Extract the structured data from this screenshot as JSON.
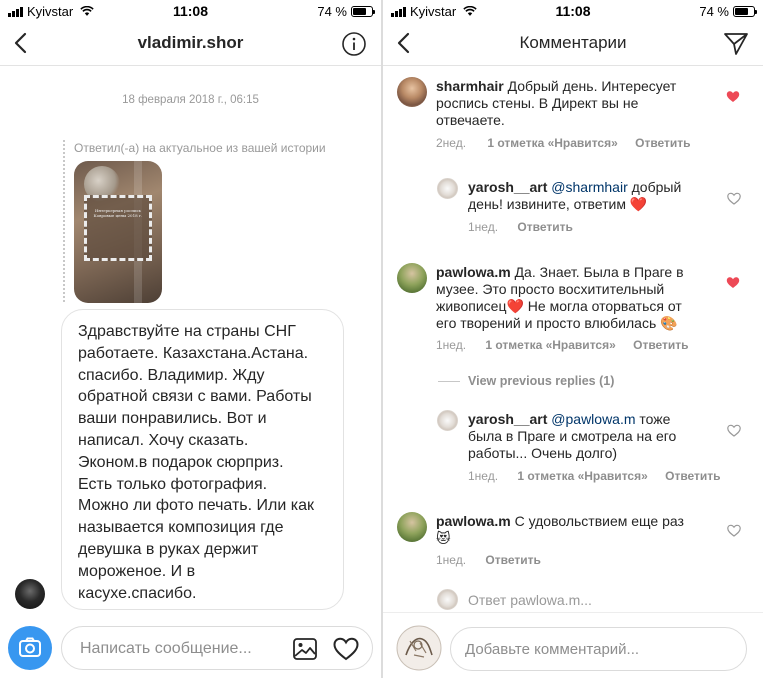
{
  "left": {
    "status": {
      "carrier": "Kyivstar",
      "time": "11:08",
      "battery": "74 %",
      "battery_level": 0.74
    },
    "title": "vladimir.shor",
    "date": "18 февраля 2018 г., 06:15",
    "reply_note": "Ответил(-а) на актуальное из вашей истории",
    "story_text": "Интерьерная роспись Ковровые цены 2018 г.",
    "message_lines": [
      "Здравствуйте на страны СНГ",
      "работаете. Казахстана.Астана.",
      "спасибо. Владимир. Жду",
      "обратной связи с вами. Работы",
      "ваши понравились. Вот и",
      "написал. Хочу сказать.",
      "Эконом.в подарок сюрприз.",
      "Есть только фотография.",
      "Можно ли фото печать. Или как",
      "называется композиция где",
      "девушка в руках держит",
      "мороженое. И в",
      "касухе.спасибо."
    ],
    "composer_placeholder": "Написать сообщение..."
  },
  "right": {
    "status": {
      "carrier": "Kyivstar",
      "time": "11:08",
      "battery": "74 %",
      "battery_level": 0.74
    },
    "title": "Комментарии",
    "comments": [
      {
        "user": "sharmhair",
        "text_lines": [
          "Добрый день. Интересует",
          "роспись стены. В Директ вы не",
          "отвечаете."
        ],
        "time": "2нед.",
        "likes": "1 отметка «Нравится»",
        "reply": "Ответить",
        "liked": true
      },
      {
        "user": "yarosh__art",
        "mention": "@sharmhair",
        "text_lines": [
          "добрый",
          "день! извините, ответим ❤️"
        ],
        "time": "1нед.",
        "reply": "Ответить",
        "liked": false
      },
      {
        "user": "pawlowa.m",
        "text_lines": [
          "Да. Знает. Была в Праге в",
          "музее. Это просто восхитительный",
          "живописец❤️ Не могла оторваться от",
          "его творений и просто влюбилась 🎨"
        ],
        "time": "1нед.",
        "likes": "1 отметка «Нравится»",
        "reply": "Ответить",
        "liked": true
      },
      {
        "user": "yarosh__art",
        "mention": "@pawlowa.m",
        "text_lines": [
          "тоже",
          "была в Праге и смотрела на его",
          "работы... Очень долго)"
        ],
        "time": "1нед.",
        "likes": "1 отметка «Нравится»",
        "reply": "Ответить",
        "liked": false
      },
      {
        "user": "pawlowa.m",
        "text_lines": [
          "С удовольствием еще раз",
          "😻"
        ],
        "time": "1нед.",
        "reply": "Ответить",
        "liked": false
      }
    ],
    "view_previous": "View previous replies (1)",
    "reply_to_placeholder": "Ответ pawlowa.m...",
    "composer_placeholder": "Добавьте комментарий..."
  },
  "colors": {
    "accent": "#3897f0",
    "like_red": "#ed4956",
    "mention": "#003569",
    "muted": "#999999"
  }
}
